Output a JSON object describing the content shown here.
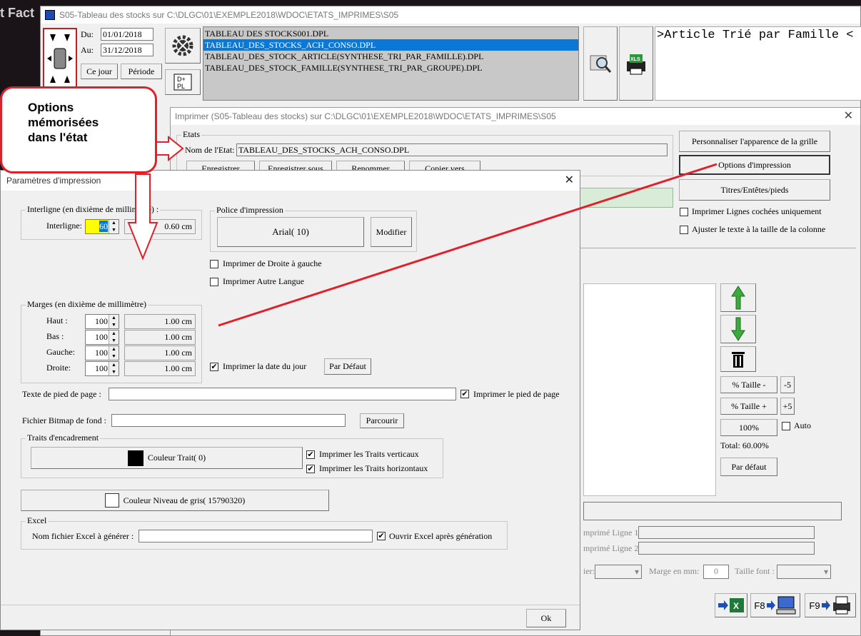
{
  "bg_app": {
    "title_fragment": "t Fact"
  },
  "main_window": {
    "title": "S05-Tableau des stocks sur C:\\DLGC\\01\\EXEMPLE2018\\WDOC\\ETATS_IMPRIMES\\S05",
    "du_label": "Du:",
    "du_value": "01/01/2018",
    "au_label": "Au:",
    "au_value": "31/12/2018",
    "ce_jour": "Ce jour",
    "periode": "Période",
    "files": [
      "TABLEAU DES STOCKS001.DPL",
      "TABLEAU_DES_STOCKS_ACH_CONSO.DPL",
      "TABLEAU_DES_STOCK_ARTICLE(SYNTHESE_TRI_PAR_FAMILLE).DPL",
      "TABLEAU_DES_STOCK_FAMILLE(SYNTHESE_TRI_PAR_GROUPE).DPL"
    ],
    "selected_index": 1,
    "right_text": ">Article Trié par Famille <"
  },
  "imprimer_window": {
    "title": "Imprimer (S05-Tableau des stocks)  sur C:\\DLGC\\01\\EXEMPLE2018\\WDOC\\ETATS_IMPRIMES\\S05",
    "etats_label": "Etats",
    "nom_label": "Nom de l'Etat:",
    "nom_value": "TABLEAU_DES_STOCKS_ACH_CONSO.DPL",
    "buttons": [
      "Enregistrer",
      "Enregistrer sous",
      "Renommer",
      "Copier vers"
    ],
    "personnaliser": "Personnaliser l'apparence de la grille",
    "options_impression": "Options d'impression",
    "titres": "Titres/Entêtes/pieds",
    "cb_lignes_cochees": "Imprimer Lignes cochées uniquement",
    "cb_ajuster": "Ajuster le texte à la taille de la colonne",
    "taille_minus": "% Taille -",
    "minus5": "-5",
    "taille_plus": "% Taille +",
    "plus5": "+5",
    "cent": "100%",
    "auto": "Auto",
    "total": "Total:  60.00%",
    "par_defaut": "Par défaut",
    "ligne1": "mprimé Ligne 1:",
    "ligne2": "mprimé Ligne 2:",
    "ier": "ier:",
    "marge_mm": "Marge en mm:",
    "marge_value": "0",
    "taille_font": "Taille font :",
    "f8": "F8",
    "f9": "F9"
  },
  "callout": {
    "text": "Options mémorisées dans l'état"
  },
  "params_dialog": {
    "title": "Paramètres d'impression",
    "interligne_group": "Interligne (en dixième de millimètre) :",
    "interligne_label": "Interligne:",
    "interligne_value": "60",
    "interligne_cm": "0.60 cm",
    "police_group": "Police d'impression",
    "police_value": "Arial( 10)",
    "modifier": "Modifier",
    "cb_droite_gauche": "Imprimer de Droite à gauche",
    "cb_autre_langue": "Imprimer Autre Langue",
    "marges_group": "Marges (en dixième de millimètre)",
    "marges": [
      {
        "label": "Haut :",
        "value": "100",
        "cm": "1.00 cm"
      },
      {
        "label": "Bas  :",
        "value": "100",
        "cm": "1.00 cm"
      },
      {
        "label": "Gauche:",
        "value": "100",
        "cm": "1.00 cm"
      },
      {
        "label": "Droite:",
        "value": "100",
        "cm": "1.00 cm"
      }
    ],
    "cb_date_jour": "Imprimer la date du jour",
    "par_defaut": "Par Défaut",
    "pied_label": "Texte de pied de page :",
    "cb_pied": "Imprimer le pied de page",
    "bitmap_label": "Fichier Bitmap de fond :",
    "parcourir": "Parcourir",
    "traits_group": "Traits d'encadrement",
    "couleur_trait": "Couleur Trait( 0)",
    "cb_verticaux": "Imprimer les Traits verticaux",
    "cb_horizontaux": "Imprimer les Traits horizontaux",
    "couleur_gris": "Couleur Niveau de gris( 15790320)",
    "excel_group": "Excel",
    "excel_label": "Nom fichier Excel à générer :",
    "cb_ouvrir_excel": "Ouvrir Excel après génération",
    "ok": "Ok"
  },
  "colors": {
    "accent_red": "#e0202a",
    "selection": "#0a78d7",
    "highlight_yellow": "#ffff00"
  }
}
